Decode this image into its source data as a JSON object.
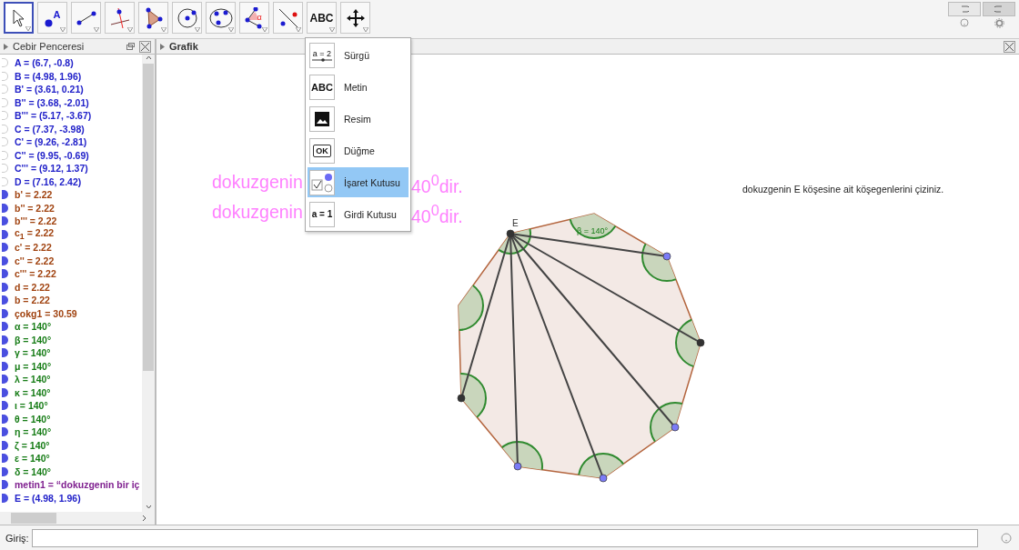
{
  "toolbar": {
    "tools": [
      {
        "kind": "move",
        "selected": true
      },
      {
        "kind": "point",
        "label": "A",
        "selected": false
      },
      {
        "kind": "segment",
        "selected": false
      },
      {
        "kind": "perpendicular",
        "selected": false
      },
      {
        "kind": "polygon",
        "selected": false
      },
      {
        "kind": "circle",
        "selected": false
      },
      {
        "kind": "ellipse",
        "selected": false
      },
      {
        "kind": "angle",
        "label": "α",
        "selected": false
      },
      {
        "kind": "reflect",
        "selected": false
      },
      {
        "kind": "text",
        "label": "ABC",
        "selected": false
      },
      {
        "kind": "pan",
        "selected": false
      }
    ]
  },
  "algebra_view": {
    "title": "Cebir Penceresi",
    "items": [
      {
        "text": "A = (6.7, -0.8)",
        "kind": "point",
        "visible": false
      },
      {
        "text": "B = (4.98, 1.96)",
        "kind": "point",
        "visible": false
      },
      {
        "text": "B' = (3.61, 0.21)",
        "kind": "point",
        "visible": false
      },
      {
        "text": "B'' = (3.68, -2.01)",
        "kind": "point",
        "visible": false
      },
      {
        "text": "B''' = (5.17, -3.67)",
        "kind": "point",
        "visible": false
      },
      {
        "text": "C = (7.37, -3.98)",
        "kind": "point",
        "visible": false
      },
      {
        "text": "C' = (9.26, -2.81)",
        "kind": "point",
        "visible": false
      },
      {
        "text": "C'' = (9.95, -0.69)",
        "kind": "point",
        "visible": false
      },
      {
        "text": "C''' = (9.12, 1.37)",
        "kind": "point",
        "visible": false
      },
      {
        "text": "D = (7.16, 2.42)",
        "kind": "point",
        "visible": false
      },
      {
        "text": "b' = 2.22",
        "kind": "number",
        "visible": true
      },
      {
        "text": "b'' = 2.22",
        "kind": "number",
        "visible": true
      },
      {
        "text": "b''' = 2.22",
        "kind": "number",
        "visible": true
      },
      {
        "text": "c$_{1}$ = 2.22",
        "kind": "number",
        "visible": true
      },
      {
        "text": "c' = 2.22",
        "kind": "number",
        "visible": true
      },
      {
        "text": "c'' = 2.22",
        "kind": "number",
        "visible": true
      },
      {
        "text": "c''' = 2.22",
        "kind": "number",
        "visible": true
      },
      {
        "text": "d = 2.22",
        "kind": "number",
        "visible": true
      },
      {
        "text": "b = 2.22",
        "kind": "number",
        "visible": true
      },
      {
        "text": "çokg1 = 30.59",
        "kind": "number",
        "visible": true
      },
      {
        "text": "α = 140°",
        "kind": "angle",
        "visible": true
      },
      {
        "text": "β = 140°",
        "kind": "angle",
        "visible": true
      },
      {
        "text": "γ = 140°",
        "kind": "angle",
        "visible": true
      },
      {
        "text": "μ = 140°",
        "kind": "angle",
        "visible": true
      },
      {
        "text": "λ = 140°",
        "kind": "angle",
        "visible": true
      },
      {
        "text": "κ = 140°",
        "kind": "angle",
        "visible": true
      },
      {
        "text": "ι = 140°",
        "kind": "angle",
        "visible": true
      },
      {
        "text": "θ = 140°",
        "kind": "angle",
        "visible": true
      },
      {
        "text": "η = 140°",
        "kind": "angle",
        "visible": true
      },
      {
        "text": "ζ = 140°",
        "kind": "angle",
        "visible": true
      },
      {
        "text": "ε = 140°",
        "kind": "angle",
        "visible": true
      },
      {
        "text": "δ = 140°",
        "kind": "angle",
        "visible": true
      },
      {
        "text": "metin1 = “dokuzgenin bir iç",
        "kind": "text",
        "visible": true
      },
      {
        "text": "E = (4.98, 1.96)",
        "kind": "point",
        "visible": true
      }
    ]
  },
  "graphics_view": {
    "title": "Grafik",
    "pink_lines": [
      {
        "before_menu": "dokuzgenin",
        "after_menu": "40$^{0}$dir."
      },
      {
        "before_menu": "dokuzgenin",
        "after_menu": "40$^{0}$dir."
      }
    ],
    "instruction": "dokuzgenin E köşesine ait köşegenlerini çiziniz.",
    "vertex_label": "E",
    "angle_label": "β = 140°"
  },
  "tool_menu": {
    "items": [
      {
        "kind": "slider",
        "icon_text": "a = 2",
        "label": "Sürgü",
        "selected": false
      },
      {
        "kind": "text",
        "icon_text": "ABC",
        "label": "Metin",
        "selected": false
      },
      {
        "kind": "image",
        "label": "Resim",
        "selected": false
      },
      {
        "kind": "button",
        "icon_text": "OK",
        "label": "Düğme",
        "selected": false
      },
      {
        "kind": "checkbox",
        "label": "İşaret Kutusu",
        "selected": true
      },
      {
        "kind": "inputbox",
        "icon_text": "a = 1",
        "label": "Girdi Kutusu",
        "selected": false
      }
    ]
  },
  "input_bar": {
    "label": "Giriş:"
  }
}
